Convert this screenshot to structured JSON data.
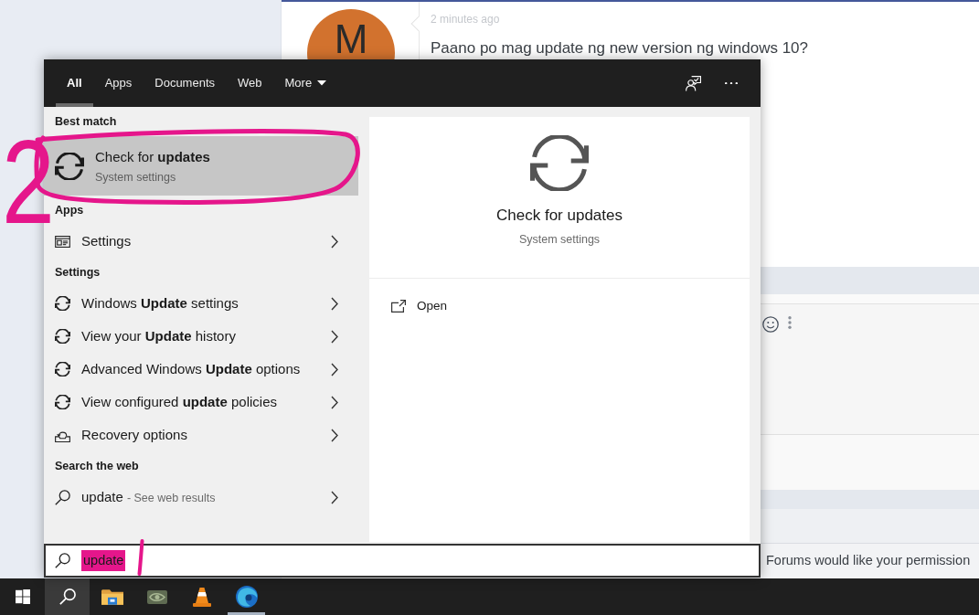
{
  "website": {
    "avatar_initial": "M",
    "comment_time": "2 minutes ago",
    "comment_text": "Paano po mag update ng new version ng windows 10?",
    "cookie_notice": "Forums would like your permission"
  },
  "search_panel": {
    "tabs": [
      {
        "label": "All",
        "selected": true,
        "dropdown": false
      },
      {
        "label": "Apps",
        "selected": false,
        "dropdown": false
      },
      {
        "label": "Documents",
        "selected": false,
        "dropdown": false
      },
      {
        "label": "Web",
        "selected": false,
        "dropdown": false
      },
      {
        "label": "More",
        "selected": false,
        "dropdown": true
      }
    ],
    "results": [
      {
        "kind": "heading",
        "label": "Best match"
      },
      {
        "kind": "best",
        "title": "Check for **updates**",
        "subtitle": "System settings",
        "selected": true
      },
      {
        "kind": "heading",
        "label": "Apps"
      },
      {
        "kind": "app",
        "label": "Settings",
        "selected": false
      },
      {
        "kind": "heading",
        "label": "Settings"
      },
      {
        "kind": "update",
        "label": "Windows **Update** settings",
        "selected": false
      },
      {
        "kind": "update",
        "label": "View your **Update** history",
        "selected": false
      },
      {
        "kind": "update",
        "label": "Advanced Windows **Update** options",
        "selected": false
      },
      {
        "kind": "update",
        "label": "View configured **update** policies",
        "selected": false
      },
      {
        "kind": "recovery",
        "label": "Recovery options",
        "selected": false
      },
      {
        "kind": "heading",
        "label": "Search the web"
      },
      {
        "kind": "web",
        "label": "update",
        "hint": "- See web results",
        "selected": false
      }
    ],
    "preview": {
      "title": "Check for updates",
      "subtitle": "System settings",
      "actions": [
        {
          "label": "Open"
        }
      ]
    },
    "search": {
      "value": "update",
      "marked": true
    }
  },
  "taskbar": {
    "buttons": [
      {
        "kind": "start",
        "selected": false,
        "running": false
      },
      {
        "kind": "search",
        "selected": true,
        "running": false
      },
      {
        "kind": "folder",
        "selected": false,
        "running": false
      },
      {
        "kind": "eye",
        "selected": false,
        "running": false
      },
      {
        "kind": "cone",
        "selected": false,
        "running": false
      },
      {
        "kind": "swirl",
        "selected": false,
        "running": true
      }
    ]
  },
  "annotations": [
    {
      "kind": "ellipse"
    },
    {
      "kind": "numeral",
      "text": "2"
    },
    {
      "kind": "stroke"
    }
  ]
}
